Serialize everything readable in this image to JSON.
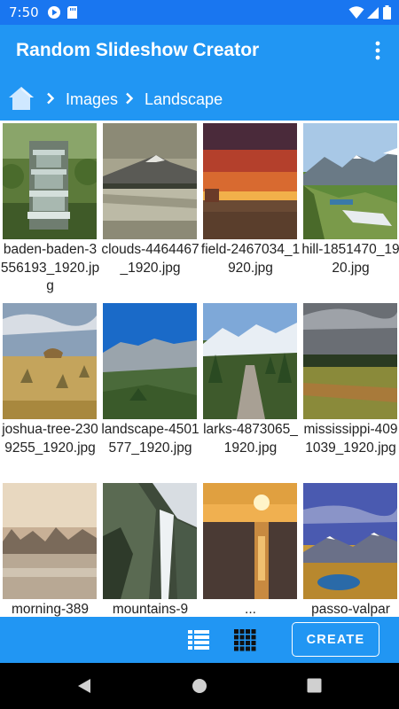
{
  "status_bar": {
    "time": "7:50",
    "icons": [
      "google-play-icon",
      "sd-card-icon",
      "wifi-icon",
      "signal-icon",
      "battery-icon"
    ]
  },
  "app_bar": {
    "title": "Random Slideshow Creator",
    "menu_icon": "more-vert-icon"
  },
  "breadcrumb": {
    "home_icon": "home-icon",
    "items": [
      "Images",
      "Landscape"
    ]
  },
  "grid": {
    "items": [
      {
        "name": "baden-baden-3556193_1920.jpg"
      },
      {
        "name": "clouds-4464467_1920.jpg"
      },
      {
        "name": "field-2467034_1920.jpg"
      },
      {
        "name": "hill-1851470_1920.jpg"
      },
      {
        "name": "joshua-tree-2309255_1920.jpg"
      },
      {
        "name": "landscape-4501577_1920.jpg"
      },
      {
        "name": "larks-4873065_1920.jpg"
      },
      {
        "name": "mississippi-4091039_1920.jpg"
      },
      {
        "name": "morning-389"
      },
      {
        "name": "mountains-9"
      },
      {
        "name": "..."
      },
      {
        "name": "passo-valpar"
      }
    ]
  },
  "bottom_bar": {
    "list_view_icon": "list-view-icon",
    "grid_view_icon": "grid-view-icon",
    "create_label": "CREATE"
  },
  "nav_bar": {
    "icons": [
      "back-icon",
      "home-circle-icon",
      "recents-icon"
    ]
  },
  "colors": {
    "status_bar": "#1976f0",
    "app_bar": "#2196f3",
    "nav_bar": "#000000",
    "caption_text": "#222222"
  }
}
